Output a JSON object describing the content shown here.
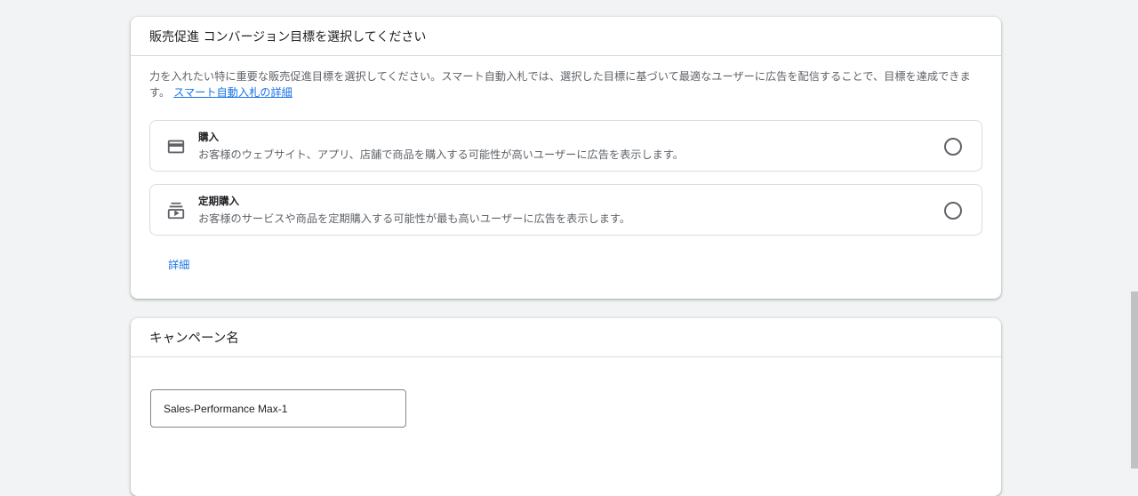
{
  "goal_card": {
    "header": "販売促進 コンバージョン目標を選択してください",
    "description": "力を入れたい特に重要な販売促進目標を選択してください。スマート自動入札では、選択した目標に基づいて最適なユーザーに広告を配信することで、目標を達成できます。",
    "learn_more_link": "スマート自動入札の詳細",
    "options": [
      {
        "icon": "credit-card-icon",
        "title": "購入",
        "description": "お客様のウェブサイト、アプリ、店舗で商品を購入する可能性が高いユーザーに広告を表示します。",
        "selected": false
      },
      {
        "icon": "subscriptions-icon",
        "title": "定期購入",
        "description": "お客様のサービスや商品を定期購入する可能性が最も高いユーザーに広告を表示します。",
        "selected": false
      }
    ],
    "details_link": "詳細"
  },
  "campaign_name_card": {
    "header": "キャンペーン名",
    "input_value": "Sales-Performance Max-1"
  },
  "colors": {
    "link": "#1a73e8",
    "background": "#f1f3f4",
    "border": "#dadce0",
    "secondary_text": "#5f6368"
  }
}
